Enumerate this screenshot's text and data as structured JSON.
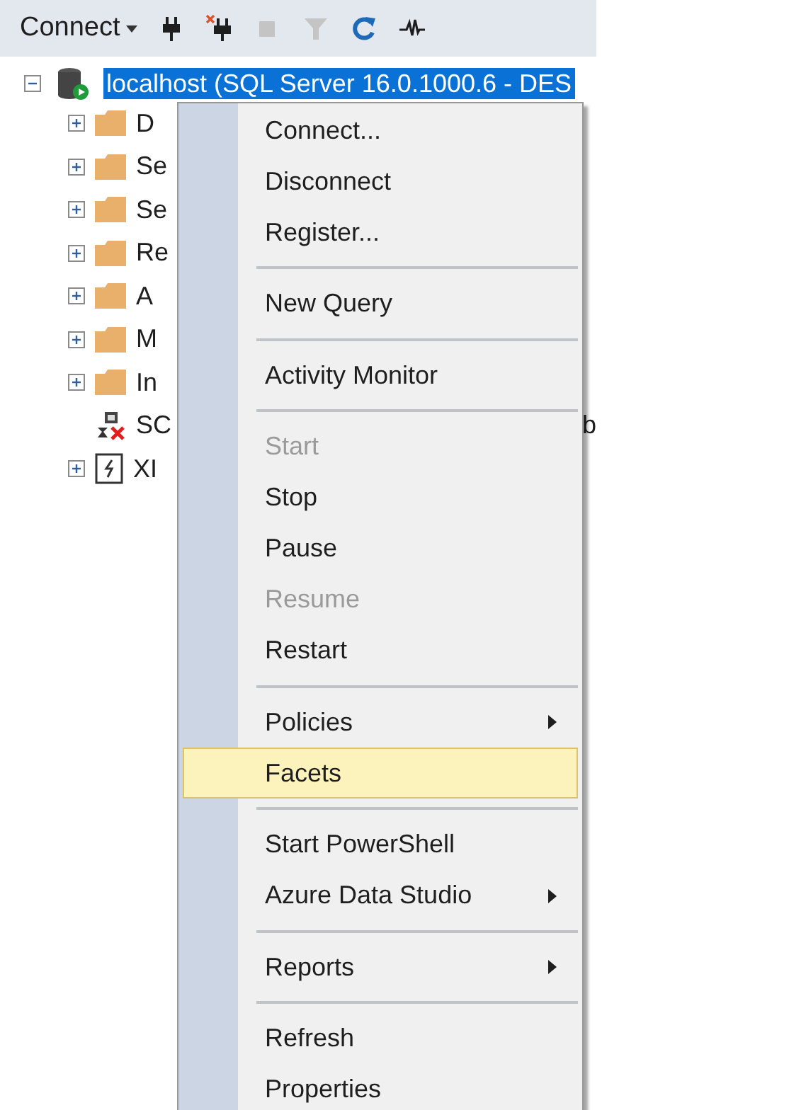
{
  "toolbar": {
    "connect_label": "Connect",
    "buttons": [
      {
        "kind": "connect",
        "disabled": false
      },
      {
        "kind": "disconnect",
        "disabled": false
      },
      {
        "kind": "stop",
        "disabled": true
      },
      {
        "kind": "filter",
        "disabled": true
      },
      {
        "kind": "refresh",
        "disabled": false
      },
      {
        "kind": "activity",
        "disabled": false
      }
    ]
  },
  "tree": {
    "server": {
      "label": "localhost (SQL Server 16.0.1000.6 - DES",
      "expanded": true,
      "selected": true
    },
    "children": [
      {
        "kind": "folder",
        "label": "D",
        "expandable": true
      },
      {
        "kind": "folder",
        "label": "Se",
        "expandable": true
      },
      {
        "kind": "folder",
        "label": "Se",
        "expandable": true
      },
      {
        "kind": "folder",
        "label": "Re",
        "expandable": true
      },
      {
        "kind": "folder",
        "label": "A",
        "expandable": true
      },
      {
        "kind": "folder",
        "label": "M",
        "expandable": true
      },
      {
        "kind": "folder",
        "label": "In",
        "expandable": true
      },
      {
        "kind": "agent",
        "label": "SC",
        "expandable": false,
        "tail": "b"
      },
      {
        "kind": "xevent",
        "label": "XI",
        "expandable": true
      }
    ]
  },
  "context_menu": [
    {
      "kind": "item",
      "label": "Connect...",
      "disabled": false,
      "selected": false,
      "submenu": false
    },
    {
      "kind": "item",
      "label": "Disconnect",
      "disabled": false,
      "selected": false,
      "submenu": false
    },
    {
      "kind": "item",
      "label": "Register...",
      "disabled": false,
      "selected": false,
      "submenu": false
    },
    {
      "kind": "separator"
    },
    {
      "kind": "item",
      "label": "New Query",
      "disabled": false,
      "selected": false,
      "submenu": false
    },
    {
      "kind": "separator"
    },
    {
      "kind": "item",
      "label": "Activity Monitor",
      "disabled": false,
      "selected": false,
      "submenu": false
    },
    {
      "kind": "separator"
    },
    {
      "kind": "item",
      "label": "Start",
      "disabled": true,
      "selected": false,
      "submenu": false
    },
    {
      "kind": "item",
      "label": "Stop",
      "disabled": false,
      "selected": false,
      "submenu": false
    },
    {
      "kind": "item",
      "label": "Pause",
      "disabled": false,
      "selected": false,
      "submenu": false
    },
    {
      "kind": "item",
      "label": "Resume",
      "disabled": true,
      "selected": false,
      "submenu": false
    },
    {
      "kind": "item",
      "label": "Restart",
      "disabled": false,
      "selected": false,
      "submenu": false
    },
    {
      "kind": "separator"
    },
    {
      "kind": "item",
      "label": "Policies",
      "disabled": false,
      "selected": false,
      "submenu": true
    },
    {
      "kind": "item",
      "label": "Facets",
      "disabled": false,
      "selected": true,
      "submenu": false
    },
    {
      "kind": "separator"
    },
    {
      "kind": "item",
      "label": "Start PowerShell",
      "disabled": false,
      "selected": false,
      "submenu": false
    },
    {
      "kind": "item",
      "label": "Azure Data Studio",
      "disabled": false,
      "selected": false,
      "submenu": true
    },
    {
      "kind": "separator"
    },
    {
      "kind": "item",
      "label": "Reports",
      "disabled": false,
      "selected": false,
      "submenu": true
    },
    {
      "kind": "separator"
    },
    {
      "kind": "item",
      "label": "Refresh",
      "disabled": false,
      "selected": false,
      "submenu": false
    },
    {
      "kind": "item",
      "label": "Properties",
      "disabled": false,
      "selected": false,
      "submenu": false
    }
  ]
}
